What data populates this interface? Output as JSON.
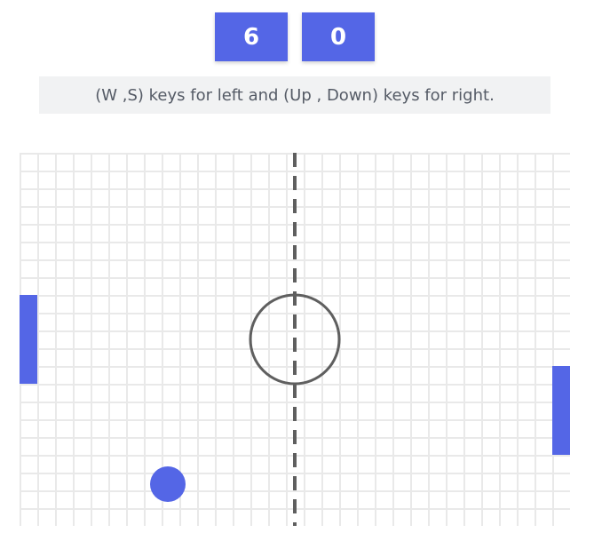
{
  "scores": {
    "left": "6",
    "right": "0"
  },
  "instructions": "(W ,S) keys for left and (Up , Down) keys for right.",
  "colors": {
    "accent": "#5466e6",
    "instructions_bg": "#f1f2f3",
    "grid_line": "#e9e9e9",
    "court_line": "#5f5f5f"
  }
}
